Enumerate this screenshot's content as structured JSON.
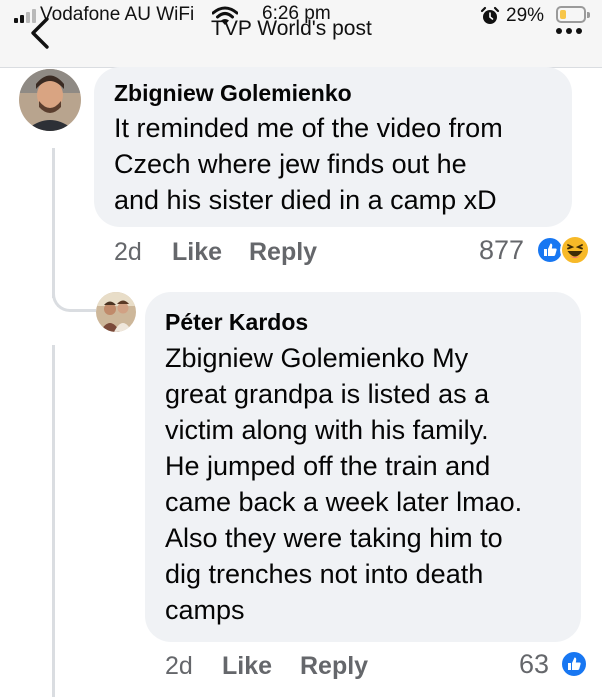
{
  "status_bar": {
    "carrier": "Vodafone AU WiFi",
    "time": "6:26 pm",
    "battery_percent": "29%",
    "battery_level": 0.29
  },
  "header": {
    "title": "TVP World's post",
    "back_icon": "chevron-left-icon",
    "more_icon": "more-dots-icon"
  },
  "comments": [
    {
      "author": "Zbigniew Golemienko",
      "lines": [
        "It reminded me of the video from",
        "Czech where jew finds out he",
        "and his sister died in a camp xD"
      ],
      "age": "2d",
      "like_label": "Like",
      "reply_label": "Reply",
      "reaction_count": "877",
      "reactions": [
        "like-reaction-icon",
        "haha-reaction-icon"
      ]
    },
    {
      "author": "Péter Kardos",
      "lines": [
        "Zbigniew Golemienko My",
        "great grandpa is listed as a",
        "victim along with his family.",
        "He jumped off the train and",
        "came back a week later lmao.",
        "Also they were taking him to",
        "dig trenches not into death",
        "camps"
      ],
      "age": "2d",
      "like_label": "Like",
      "reply_label": "Reply",
      "reaction_count": "63",
      "reactions": [
        "like-reaction-icon"
      ]
    }
  ],
  "colors": {
    "bubble": "#f0f2f5",
    "meta_text": "#65676b",
    "like_blue": "#1877f2",
    "haha_yellow": "#f7b928"
  }
}
